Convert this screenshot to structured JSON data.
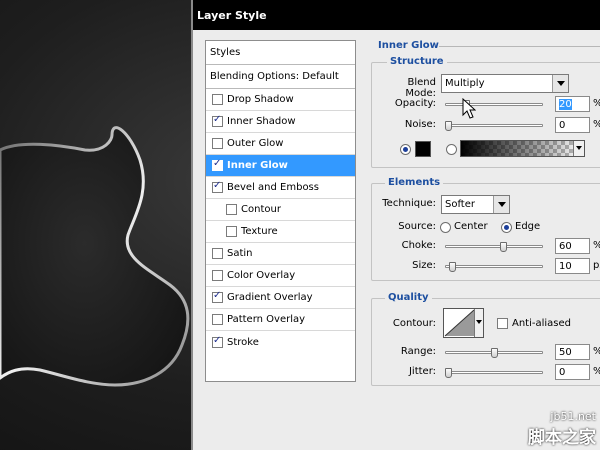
{
  "window": {
    "title": "Layer Style"
  },
  "styles_list": {
    "header": "Styles",
    "blending_options": "Blending Options: Default",
    "items": [
      {
        "label": "Drop Shadow",
        "checked": false
      },
      {
        "label": "Inner Shadow",
        "checked": true
      },
      {
        "label": "Outer Glow",
        "checked": false
      },
      {
        "label": "Inner Glow",
        "checked": true,
        "selected": true
      },
      {
        "label": "Bevel and Emboss",
        "checked": true
      },
      {
        "label": "Contour",
        "checked": false,
        "indent": true
      },
      {
        "label": "Texture",
        "checked": false,
        "indent": true
      },
      {
        "label": "Satin",
        "checked": false
      },
      {
        "label": "Color Overlay",
        "checked": false
      },
      {
        "label": "Gradient Overlay",
        "checked": true
      },
      {
        "label": "Pattern Overlay",
        "checked": false
      },
      {
        "label": "Stroke",
        "checked": true
      }
    ]
  },
  "inner_glow": {
    "title": "Inner Glow",
    "structure": {
      "title": "Structure",
      "blend_mode_label": "Blend Mode:",
      "blend_mode_value": "Multiply",
      "opacity_label": "Opacity:",
      "opacity_value": "20",
      "opacity_level": 0.2,
      "opacity_unit": "%",
      "noise_label": "Noise:",
      "noise_value": "0",
      "noise_level": 0,
      "noise_unit": "%",
      "glow_color": "#000000"
    },
    "elements": {
      "title": "Elements",
      "technique_label": "Technique:",
      "technique_value": "Softer",
      "source_label": "Source:",
      "source_center": "Center",
      "source_edge": "Edge",
      "choke_label": "Choke:",
      "choke_value": "60",
      "choke_level": 0.6,
      "choke_unit": "%",
      "size_label": "Size:",
      "size_value": "10",
      "size_level": 0.04,
      "size_unit": "px"
    },
    "quality": {
      "title": "Quality",
      "contour_label": "Contour:",
      "anti_aliased_label": "Anti-aliased",
      "range_label": "Range:",
      "range_value": "50",
      "range_level": 0.5,
      "range_unit": "%",
      "jitter_label": "Jitter:",
      "jitter_value": "0",
      "jitter_level": 0,
      "jitter_unit": "%"
    }
  },
  "watermark": {
    "url": "jb51.net",
    "name": "脚本之家"
  },
  "colors": {
    "accent": "#3399ff",
    "group_title": "#1d4fa0",
    "titlebar": "#000000"
  }
}
